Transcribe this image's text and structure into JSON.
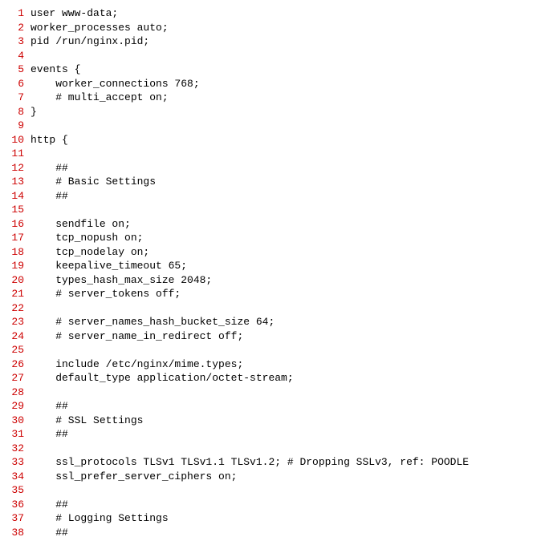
{
  "lines": [
    {
      "n": "1",
      "text": "user www-data;"
    },
    {
      "n": "2",
      "text": "worker_processes auto;"
    },
    {
      "n": "3",
      "text": "pid /run/nginx.pid;"
    },
    {
      "n": "4",
      "text": ""
    },
    {
      "n": "5",
      "text": "events {"
    },
    {
      "n": "6",
      "text": "    worker_connections 768;"
    },
    {
      "n": "7",
      "text": "    # multi_accept on;"
    },
    {
      "n": "8",
      "text": "}"
    },
    {
      "n": "9",
      "text": ""
    },
    {
      "n": "10",
      "text": "http {"
    },
    {
      "n": "11",
      "text": ""
    },
    {
      "n": "12",
      "text": "    ##"
    },
    {
      "n": "13",
      "text": "    # Basic Settings"
    },
    {
      "n": "14",
      "text": "    ##"
    },
    {
      "n": "15",
      "text": ""
    },
    {
      "n": "16",
      "text": "    sendfile on;"
    },
    {
      "n": "17",
      "text": "    tcp_nopush on;"
    },
    {
      "n": "18",
      "text": "    tcp_nodelay on;"
    },
    {
      "n": "19",
      "text": "    keepalive_timeout 65;"
    },
    {
      "n": "20",
      "text": "    types_hash_max_size 2048;"
    },
    {
      "n": "21",
      "text": "    # server_tokens off;"
    },
    {
      "n": "22",
      "text": ""
    },
    {
      "n": "23",
      "text": "    # server_names_hash_bucket_size 64;"
    },
    {
      "n": "24",
      "text": "    # server_name_in_redirect off;"
    },
    {
      "n": "25",
      "text": ""
    },
    {
      "n": "26",
      "text": "    include /etc/nginx/mime.types;"
    },
    {
      "n": "27",
      "text": "    default_type application/octet-stream;"
    },
    {
      "n": "28",
      "text": ""
    },
    {
      "n": "29",
      "text": "    ##"
    },
    {
      "n": "30",
      "text": "    # SSL Settings"
    },
    {
      "n": "31",
      "text": "    ##"
    },
    {
      "n": "32",
      "text": ""
    },
    {
      "n": "33",
      "text": "    ssl_protocols TLSv1 TLSv1.1 TLSv1.2; # Dropping SSLv3, ref: POODLE"
    },
    {
      "n": "34",
      "text": "    ssl_prefer_server_ciphers on;"
    },
    {
      "n": "35",
      "text": ""
    },
    {
      "n": "36",
      "text": "    ##"
    },
    {
      "n": "37",
      "text": "    # Logging Settings"
    },
    {
      "n": "38",
      "text": "    ##"
    }
  ]
}
